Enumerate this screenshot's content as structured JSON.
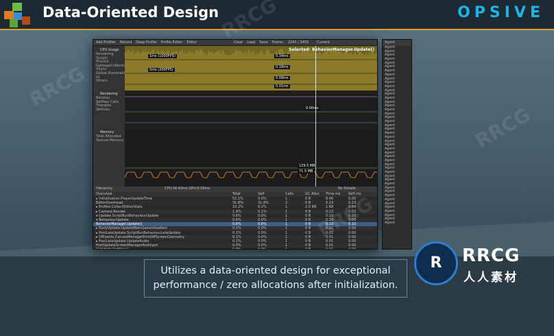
{
  "header": {
    "title": "Data-Oriented Design",
    "brand": "OPSIVE"
  },
  "profiler": {
    "toolbar": [
      "Add Profiler",
      "Record",
      "Deep Profile",
      "Profile Editor",
      "Editor",
      "Clear",
      "Load",
      "Save",
      "Frame:",
      "2243 / 2455",
      "Current"
    ],
    "selected": "Selected: BehaviorManager.Update()",
    "cpu_label": "CPU Usage",
    "cpu_items": [
      "Rendering",
      "Scripts",
      "Physics",
      "GarbageCollector",
      "VSync",
      "Global Illumination",
      "UI",
      "Others"
    ],
    "rendering_label": "Rendering",
    "rendering_items": [
      "Batches",
      "SetPass Calls",
      "Triangles",
      "Vertices"
    ],
    "memory_label": "Memory",
    "memory_items": [
      "Total Allocated",
      "Texture Memory"
    ],
    "chips": {
      "fps1": "1ms (1000FPS)",
      "fps2": "5ms (200FPS)",
      "v1": "0.34ms",
      "v2": "0.18ms",
      "v3": "0.08ms",
      "v4": "0.01ms",
      "v5": "0.00ms",
      "m1": "129.5 MB",
      "m2": "71.5 MB"
    },
    "hier_bar": {
      "left": "Hierarchy",
      "mid": "CPU:16.42ms  GPU:0.00ms",
      "right": "No Details"
    },
    "columns": [
      "Overview",
      "Total",
      "Self",
      "Calls",
      "GC Alloc",
      "Time ms",
      "Self ms"
    ],
    "rows": [
      [
        "▸ Initialization.PlayerUpdateTime",
        "52.1%",
        "0.0%",
        "1",
        "0 B",
        "8.46",
        "0.00"
      ],
      [
        "  EditorOverhead",
        "31.8%",
        "31.8%",
        "2",
        "0 B",
        "5.23",
        "5.23"
      ],
      [
        "▸ Profiler.CollectEditorStats",
        "10.2%",
        "0.2%",
        "1",
        "2.0 KB",
        "1.68",
        "0.04"
      ],
      [
        "▸ Camera.Render",
        "1.4%",
        "0.1%",
        "1",
        "0 B",
        "0.23",
        "0.02"
      ],
      [
        "▾ Update.ScriptRunBehaviourUpdate",
        "0.6%",
        "0.0%",
        "1",
        "0 B",
        "0.10",
        "0.00"
      ],
      [
        "  ▾ BehaviourUpdate",
        "0.6%",
        "0.0%",
        "1",
        "0 B",
        "0.10",
        "0.00"
      ],
      [
        "      BehaviorManager.Update()",
        "0.6%",
        "0.6%",
        "1",
        "0 B",
        "0.10",
        "0.10"
      ],
      [
        "▸ EarlyUpdate.UpdateMainGameViewRect",
        "0.1%",
        "0.0%",
        "1",
        "0 B",
        "0.02",
        "0.00"
      ],
      [
        "▸ PostLateUpdate.ScriptRunBehaviourLateUpdate",
        "0.1%",
        "0.0%",
        "1",
        "0 B",
        "0.02",
        "0.00"
      ],
      [
        "▸ UIEvents.CanvasManagerEmitOffScreenGeometry",
        "0.1%",
        "0.0%",
        "1",
        "0 B",
        "0.01",
        "0.00"
      ],
      [
        "▸ PostLateUpdate.UpdateAudio",
        "0.1%",
        "0.0%",
        "1",
        "0 B",
        "0.01",
        "0.00"
      ],
      [
        "  PostUpdateScreenManagerAndInput",
        "0.0%",
        "0.0%",
        "1",
        "0 B",
        "0.01",
        "0.00"
      ],
      [
        "  GUIUtility.SetSkin()",
        "0.0%",
        "0.0%",
        "1",
        "0 B",
        "0.01",
        "0.00"
      ],
      [
        "▸ PostLateUpdate.UpdateCustomRenderTextures",
        "0.0%",
        "0.0%",
        "1",
        "0 B",
        "0.00",
        "0.00"
      ],
      [
        "▸ PreUpdate.SendMouseEvents",
        "0.0%",
        "0.0%",
        "1",
        "0 B",
        "0.00",
        "0.00"
      ],
      [
        "▸ PostLateUpdate.PlayerSendFrameComplete",
        "0.0%",
        "0.0%",
        "1",
        "0 B",
        "0.00",
        "0.00"
      ],
      [
        "▸ PostLateUpdate.UpdateAllRenderers",
        "0.0%",
        "0.0%",
        "1",
        "0 B",
        "0.00",
        "0.00"
      ]
    ],
    "side_header": "Agent",
    "side_items": [
      "Agent",
      "Agent",
      "Agent",
      "Agent",
      "Agent",
      "Agent",
      "Agent",
      "Agent",
      "Agent",
      "Agent",
      "Agent",
      "Agent",
      "Agent",
      "Agent",
      "Agent",
      "Agent",
      "Agent",
      "Agent",
      "Agent",
      "Agent",
      "Agent",
      "Agent",
      "Agent",
      "Agent",
      "Agent",
      "Agent",
      "Agent",
      "Agent",
      "Agent",
      "Agent",
      "Agent",
      "Agent",
      "Agent",
      "Agent",
      "Agent",
      "Agent",
      "Agent",
      "Agent",
      "Agent",
      "Agent",
      "Agent",
      "Agent",
      "Agent",
      "Agent",
      "Agent",
      "Agent"
    ]
  },
  "caption": {
    "line1": "Utilizes a data-oriented design for exceptional",
    "line2": "performance / zero allocations after initialization."
  },
  "watermark": {
    "logo": "RRCG",
    "subtitle": "人人素材"
  },
  "colors": {
    "accent": "#e79a2c",
    "brand": "#1eb4e6",
    "cpu": "#6f6424",
    "highlight": "#3e5f8a"
  }
}
